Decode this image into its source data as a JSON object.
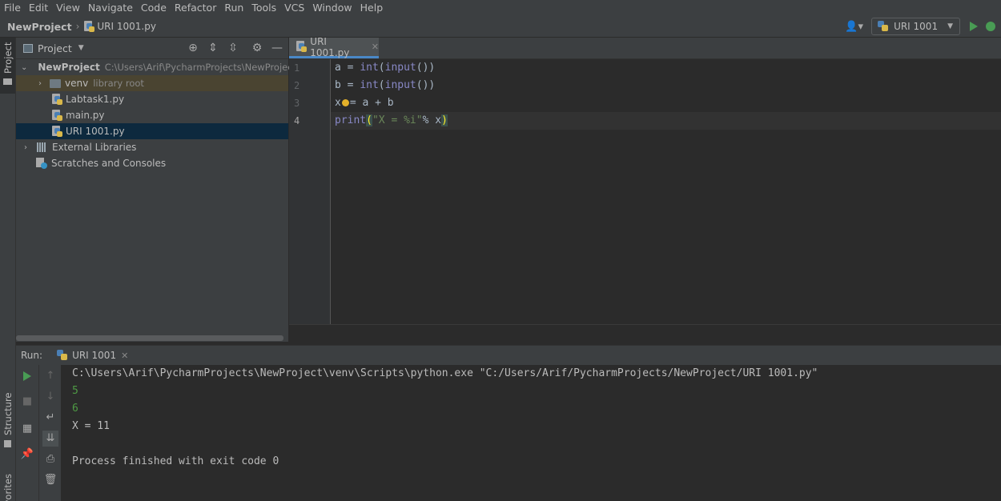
{
  "menu": [
    "File",
    "Edit",
    "View",
    "Navigate",
    "Code",
    "Refactor",
    "Run",
    "Tools",
    "VCS",
    "Window",
    "Help"
  ],
  "breadcrumb": {
    "project": "NewProject",
    "file": "URI 1001.py"
  },
  "toolbar": {
    "run_config": "URI 1001"
  },
  "side_tabs": {
    "project": "Project",
    "structure": "Structure",
    "favorites": "Favorites"
  },
  "project_panel": {
    "title": "Project",
    "tree": [
      {
        "label": "NewProject",
        "detail": "C:\\Users\\Arif\\PycharmProjects\\NewProject"
      },
      {
        "label": "venv",
        "detail": "library root"
      },
      {
        "label": "Labtask1.py"
      },
      {
        "label": "main.py"
      },
      {
        "label": "URI 1001.py"
      },
      {
        "label": "External Libraries"
      },
      {
        "label": "Scratches and Consoles"
      }
    ]
  },
  "editor": {
    "tab": "URI 1001.py",
    "line_numbers": [
      "1",
      "2",
      "3",
      "4"
    ],
    "lines": [
      {
        "a": "a = ",
        "b": "int",
        "c": "(",
        "d": "input",
        "e": "())"
      },
      {
        "a": "b = ",
        "b": "int",
        "c": "(",
        "d": "input",
        "e": "())"
      },
      {
        "a": "x",
        "b": "= a + b"
      },
      {
        "a": "print",
        "b": "(",
        "c": "\"X = %i\"",
        "d": "% x",
        "e": ")"
      }
    ]
  },
  "run": {
    "label": "Run:",
    "tab": "URI 1001",
    "console": [
      {
        "text": "C:\\Users\\Arif\\PycharmProjects\\NewProject\\venv\\Scripts\\python.exe \"C:/Users/Arif/PycharmProjects/NewProject/URI 1001.py\"",
        "kind": "cmd"
      },
      {
        "text": "5",
        "kind": "input"
      },
      {
        "text": "6",
        "kind": "input"
      },
      {
        "text": "X = 11",
        "kind": "out"
      },
      {
        "text": "",
        "kind": "out"
      },
      {
        "text": "Process finished with exit code 0",
        "kind": "out"
      }
    ]
  },
  "colors": {
    "accent": "#4a88c7",
    "run_green": "#499c54",
    "keyword": "#8888c6",
    "string": "#6a8759"
  }
}
